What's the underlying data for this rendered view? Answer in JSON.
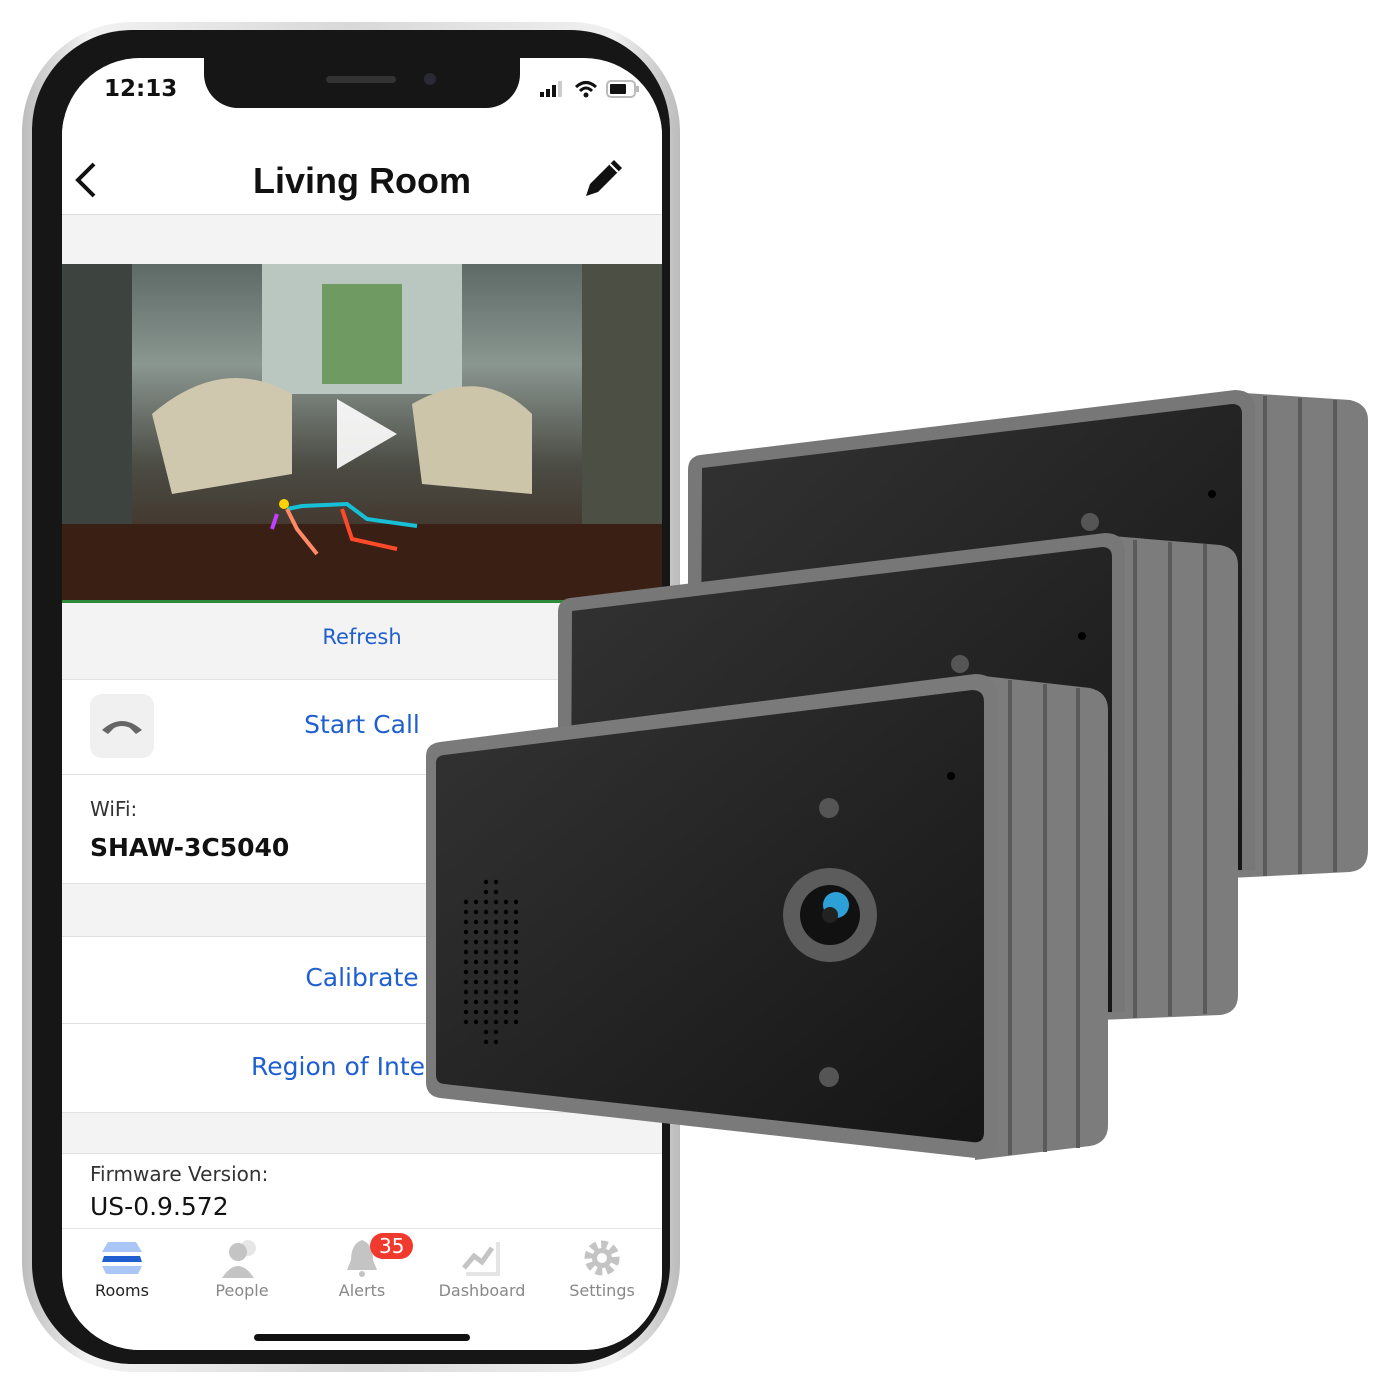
{
  "status_bar": {
    "time": "12:13"
  },
  "header": {
    "title": "Living Room",
    "back_icon": "chevron-left-icon",
    "edit_icon": "pencil-icon"
  },
  "camera": {
    "play_icon": "play-icon"
  },
  "actions": {
    "refresh": "Refresh",
    "start_call": "Start Call",
    "call_icon": "phone-hangup-icon",
    "calibrate": "Calibrate",
    "region": "Region of Interest"
  },
  "wifi": {
    "label": "WiFi:",
    "value": "SHAW-3C5040"
  },
  "firmware": {
    "label": "Firmware Version:",
    "value": "US-0.9.572"
  },
  "tabs": [
    {
      "label": "Rooms",
      "icon": "layers-icon",
      "active": true
    },
    {
      "label": "People",
      "icon": "people-icon"
    },
    {
      "label": "Alerts",
      "icon": "bell-icon",
      "badge": "35"
    },
    {
      "label": "Dashboard",
      "icon": "chart-icon"
    },
    {
      "label": "Settings",
      "icon": "gear-icon"
    }
  ],
  "colors": {
    "accent": "#1f5fcf",
    "badge": "#f03a2e",
    "device_body": "#7a7a7a",
    "device_face": "#1c1c1c"
  }
}
